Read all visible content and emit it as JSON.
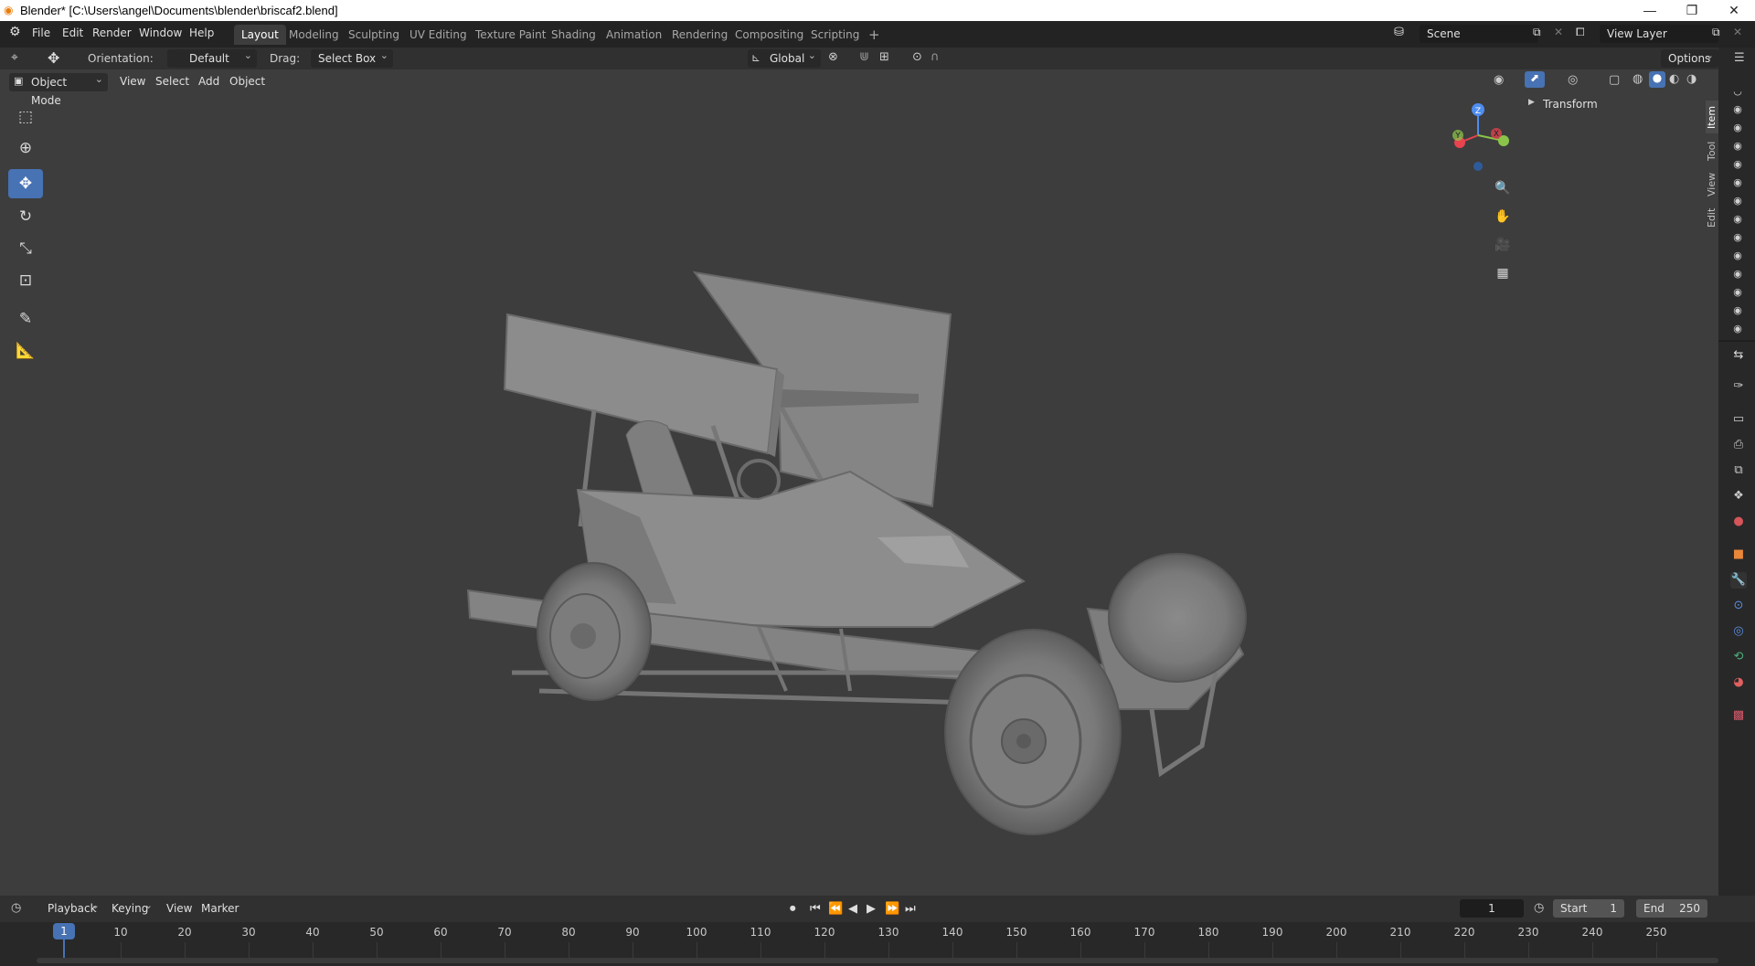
{
  "window": {
    "title": "Blender* [C:\\Users\\angel\\Documents\\blender\\briscaf2.blend]",
    "minimize": "—",
    "restore": "❐",
    "close": "✕"
  },
  "menubar": {
    "items": [
      "File",
      "Edit",
      "Render",
      "Window",
      "Help"
    ]
  },
  "workspaces": {
    "tabs": [
      "Layout",
      "Modeling",
      "Sculpting",
      "UV Editing",
      "Texture Paint",
      "Shading",
      "Animation",
      "Rendering",
      "Compositing",
      "Scripting"
    ],
    "active": "Layout",
    "add": "+"
  },
  "scene": {
    "name": "Scene",
    "view_layer": "View Layer"
  },
  "toolheader": {
    "orientation_label": "Orientation:",
    "orientation_value": "Default",
    "drag_label": "Drag:",
    "drag_value": "Select Box",
    "transform_orientation": "Global",
    "options": "Options"
  },
  "viewport_header": {
    "mode": "Object Mode",
    "menus": [
      "View",
      "Select",
      "Add",
      "Object"
    ]
  },
  "sidebar": {
    "panel": "Transform",
    "tabs": [
      "Item",
      "Tool",
      "View",
      "Edit"
    ]
  },
  "gizmo": {
    "z": "Z",
    "y": "Y",
    "x": "X"
  },
  "timeline": {
    "menus": [
      "Playback",
      "Keying",
      "View",
      "Marker"
    ],
    "current_frame": "1",
    "start_label": "Start",
    "start": "1",
    "end_label": "End",
    "end": "250",
    "ticks": [
      "10",
      "20",
      "30",
      "40",
      "50",
      "60",
      "70",
      "80",
      "90",
      "100",
      "110",
      "120",
      "130",
      "140",
      "150",
      "160",
      "170",
      "180",
      "190",
      "200",
      "210",
      "220",
      "230",
      "240",
      "250"
    ]
  },
  "colors": {
    "accent": "#4772b3",
    "background": "#3d3d3d",
    "header": "#303030",
    "axis_x": "#e8434f",
    "axis_y": "#8bc34a",
    "axis_z": "#4e8df0"
  }
}
